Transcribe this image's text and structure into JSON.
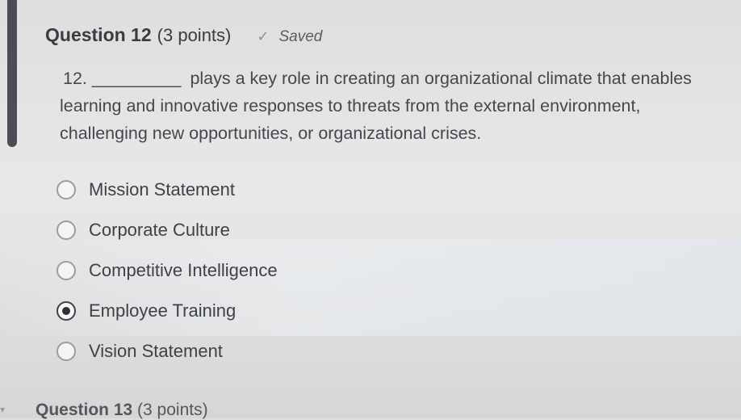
{
  "question": {
    "title": "Question 12",
    "points": "(3 points)",
    "status": "Saved",
    "status_icon": "check-icon",
    "number": "12.",
    "blank": "__________",
    "text_line1": "plays a key role in creating an organizational climate that enables",
    "text_line2": "learning and innovative responses to threats from the external environment,",
    "text_line3": "challenging new opportunities, or organizational crises."
  },
  "options": [
    {
      "label": "Mission Statement",
      "selected": false
    },
    {
      "label": "Corporate Culture",
      "selected": false
    },
    {
      "label": "Competitive Intelligence",
      "selected": false
    },
    {
      "label": "Employee Training",
      "selected": true
    },
    {
      "label": "Vision Statement",
      "selected": false
    }
  ],
  "next_question": {
    "title": "Question 13",
    "points": "(3 points)"
  },
  "colors": {
    "accent_bar": "#4b4d55",
    "text": "#3d3d44"
  }
}
